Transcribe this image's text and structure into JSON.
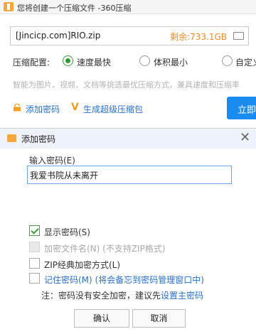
{
  "window": {
    "title": "您将创建一个压缩文件 -360压缩"
  },
  "file": {
    "name": "[Jincicp.com]RIO.zip",
    "remaining": "剩余:733.1GB"
  },
  "compress": {
    "label": "压缩配置:",
    "options": [
      {
        "label": "速度最快",
        "selected": true
      },
      {
        "label": "体积最小",
        "selected": false
      },
      {
        "label": "自定义",
        "selected": false
      }
    ]
  },
  "description": "智能为图片、视频、文档等挑选最优压缩方式，兼具速度和压缩率",
  "links": {
    "add_password": "添加密码",
    "super_pack": "生成超级压缩包"
  },
  "now_button": "立即",
  "dialog": {
    "title": "添加密码",
    "close": "✕",
    "password_label": "输入密码(E)",
    "password_value": "我爱书院从未离开",
    "options": {
      "show_password": {
        "label": "显示密码(S)",
        "checked": true
      },
      "encrypt_names": {
        "label": "加密文件名(N) (不支持ZIP格式)",
        "checked": false,
        "disabled": true
      },
      "zip_classic": {
        "label": "ZIP经典加密方式(L)",
        "checked": false
      },
      "remember": {
        "label": "记住密码(M) (将会备忘到密码管理窗口中)",
        "checked": false
      }
    },
    "note_prefix": "注：密码没有安全加密，建议先",
    "note_link": "设置主密码",
    "ok_button": "确认",
    "cancel_button": "取消"
  },
  "colors": {
    "accent_blue": "#1a8cf0",
    "link_blue": "#2a6fc9",
    "remaining_orange": "#f08a24",
    "check_green": "#3a9a3a"
  }
}
